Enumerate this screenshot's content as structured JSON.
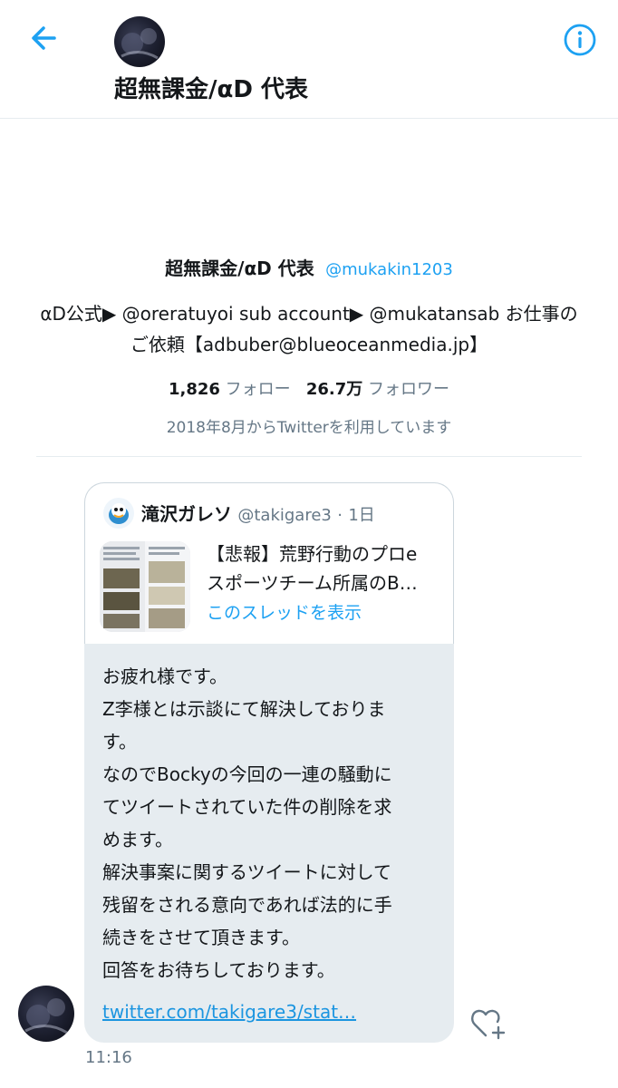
{
  "header": {
    "title": "超無課金/αD 代表",
    "back_icon": "arrow-left-icon",
    "info_icon": "info-icon",
    "accent": "#1da1f2"
  },
  "profile": {
    "name": "超無課金/αD 代表",
    "handle": "@mukakin1203",
    "bio_line1": "αD公式▶ @oreratuyoi sub account▶ @mukatansab お仕事の",
    "bio_line2": "ご依頼【adbuber@blueoceanmedia.jp】",
    "following_count": "1,826",
    "following_label": "フォロー",
    "followers_count": "26.7万",
    "followers_label": "フォロワー",
    "joined": "2018年8月からTwitterを利用しています"
  },
  "card": {
    "name": "滝沢ガレソ",
    "handle": "@takigare3",
    "separator": "·",
    "time": "1日",
    "title_line1": "【悲報】荒野行動のプロe",
    "title_line2": "スポーツチーム所属のB…",
    "link": "このスレッドを表示"
  },
  "message": {
    "lines": [
      "お疲れ様です。",
      "Z李様とは示談にて解決しておりま",
      "す。",
      "なのでBockyの今回の一連の騒動に",
      "てツイートされていた件の削除を求",
      "めます。",
      "解決事案に関するツイートに対して",
      "残留をされる意向であれば法的に手",
      "続きをさせて頂きます。",
      "回答をお待ちしております。"
    ],
    "link": "twitter.com/takigare3/stat…",
    "time": "11:16",
    "like_icon": "heart-plus-icon",
    "bubble_color": "#e6ecf0"
  }
}
